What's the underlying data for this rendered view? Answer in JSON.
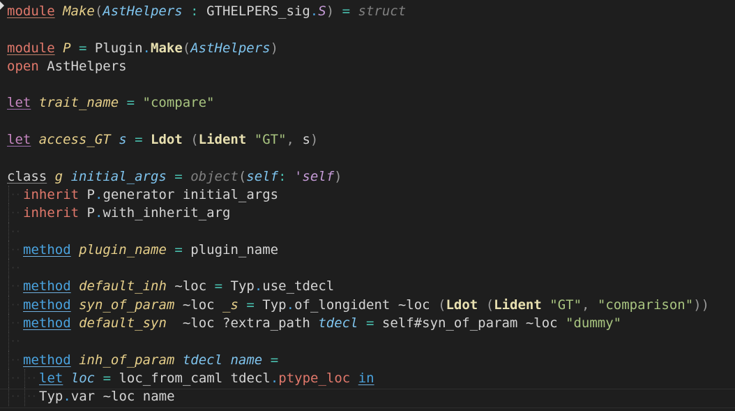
{
  "editor": {
    "t": {
      "module": "module",
      "make": "Make",
      "asthelpers": "AstHelpers",
      "gthelpers": "GTHELPERS_sig",
      "S": "S",
      "struct": "struct",
      "P": "P",
      "plugin": "Plugin",
      "open": "open",
      "let": "let",
      "trait_name": "trait_name",
      "compare": "\"compare\"",
      "access_GT": "access_GT",
      "s": "s",
      "Ldot": "Ldot",
      "Lident": "Lident",
      "GT": "\"GT\"",
      "class": "class",
      "gvar": "g",
      "initial_args": "initial_args",
      "object": "object",
      "self": "self",
      "tself": "'self",
      "inherit": "inherit",
      "generator": "generator",
      "with_inherit_arg": "with_inherit_arg",
      "method": "method",
      "plugin_name": "plugin_name",
      "default_inh": "default_inh",
      "loc_lab": "~loc",
      "Typ": "Typ",
      "use_tdecl": "use_tdecl",
      "syn_of_param": "syn_of_param",
      "us_s": "_s",
      "of_longident": "of_longident",
      "comparison": "\"comparison\"",
      "default_syn": "default_syn",
      "extra_path": "?extra_path",
      "tdecl": "tdecl",
      "selfhash": "self#syn_of_param",
      "dummy": "\"dummy\"",
      "inh_of_param": "inh_of_param",
      "name": "name",
      "loc": "loc",
      "loc_from_caml": "loc_from_caml",
      "ptype_loc": "ptype_loc",
      "in": "in",
      "var": "var"
    }
  }
}
